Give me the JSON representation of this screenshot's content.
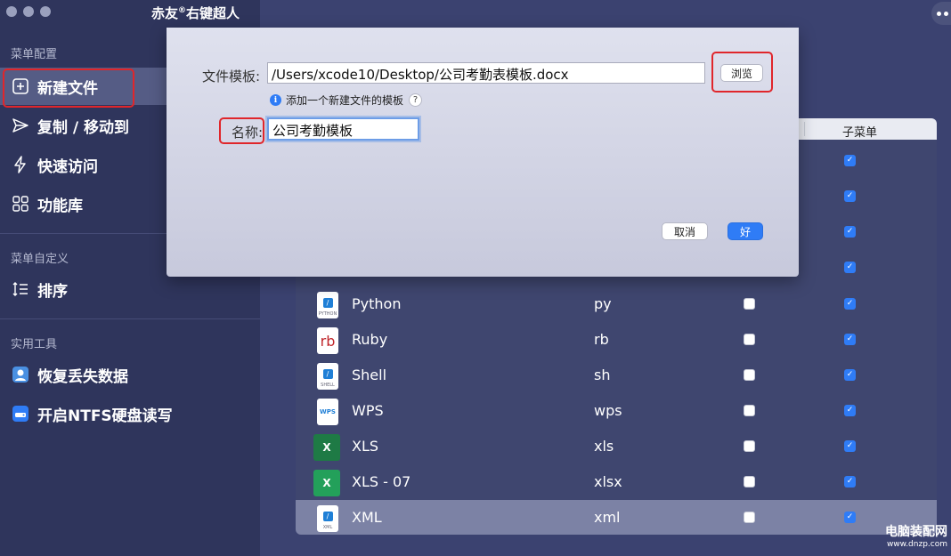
{
  "app": {
    "title": "赤友",
    "registered": "®",
    "title_rest": "右键超人"
  },
  "sidebar": {
    "section_menu_config": "菜单配置",
    "items_config": [
      {
        "label": "新建文件",
        "icon": "plus-square-icon"
      },
      {
        "label": "复制 / 移动到",
        "icon": "send-icon"
      },
      {
        "label": "快速访问",
        "icon": "lightning-icon"
      },
      {
        "label": "功能库",
        "icon": "grid-icon"
      }
    ],
    "section_custom": "菜单自定义",
    "items_custom": [
      {
        "label": "排序",
        "icon": "sort-icon"
      }
    ],
    "section_tools": "实用工具",
    "items_tools": [
      {
        "label": "恢复丢失数据",
        "icon": "recover-data-icon"
      },
      {
        "label": "开启NTFS硬盘读写",
        "icon": "ntfs-icon"
      }
    ]
  },
  "table": {
    "header_submenu": "子菜单",
    "rows": [
      {
        "name": "Python",
        "ext": "py",
        "icon": "python-file-icon",
        "checked": false,
        "submenu": true
      },
      {
        "name": "Ruby",
        "ext": "rb",
        "icon": "ruby-file-icon",
        "checked": false,
        "submenu": true
      },
      {
        "name": "Shell",
        "ext": "sh",
        "icon": "shell-file-icon",
        "checked": false,
        "submenu": true
      },
      {
        "name": "WPS",
        "ext": "wps",
        "icon": "wps-file-icon",
        "checked": false,
        "submenu": true
      },
      {
        "name": "XLS",
        "ext": "xls",
        "icon": "xls-file-icon",
        "checked": false,
        "submenu": true
      },
      {
        "name": "XLS - 07",
        "ext": "xlsx",
        "icon": "xlsx-file-icon",
        "checked": false,
        "submenu": true
      },
      {
        "name": "XML",
        "ext": "xml",
        "icon": "xml-file-icon",
        "checked": false,
        "submenu": true
      }
    ],
    "icon_tiny_labels": {
      "python": "PYTHON",
      "shell": "SHELL",
      "wps": "WPS",
      "xml": "XML",
      "rb": "rb",
      "x": "X"
    }
  },
  "dialog": {
    "template_label": "文件模板:",
    "template_value": "/Users/xcode10/Desktop/公司考勤表模板.docx",
    "browse_button": "浏览",
    "hint_text": "添加一个新建文件的模板",
    "info_glyph": "i",
    "help_glyph": "?",
    "name_label": "名称:",
    "name_value": "公司考勤模板",
    "cancel_button": "取消",
    "ok_button": "好"
  },
  "watermark": {
    "line1": "电脑装配网",
    "line2": "www.dnzp.com"
  },
  "colors": {
    "accent": "#2f7cf6",
    "highlight_red": "#e0262b",
    "sidebar_bg": "#2f355c",
    "main_bg": "#3b4270"
  }
}
